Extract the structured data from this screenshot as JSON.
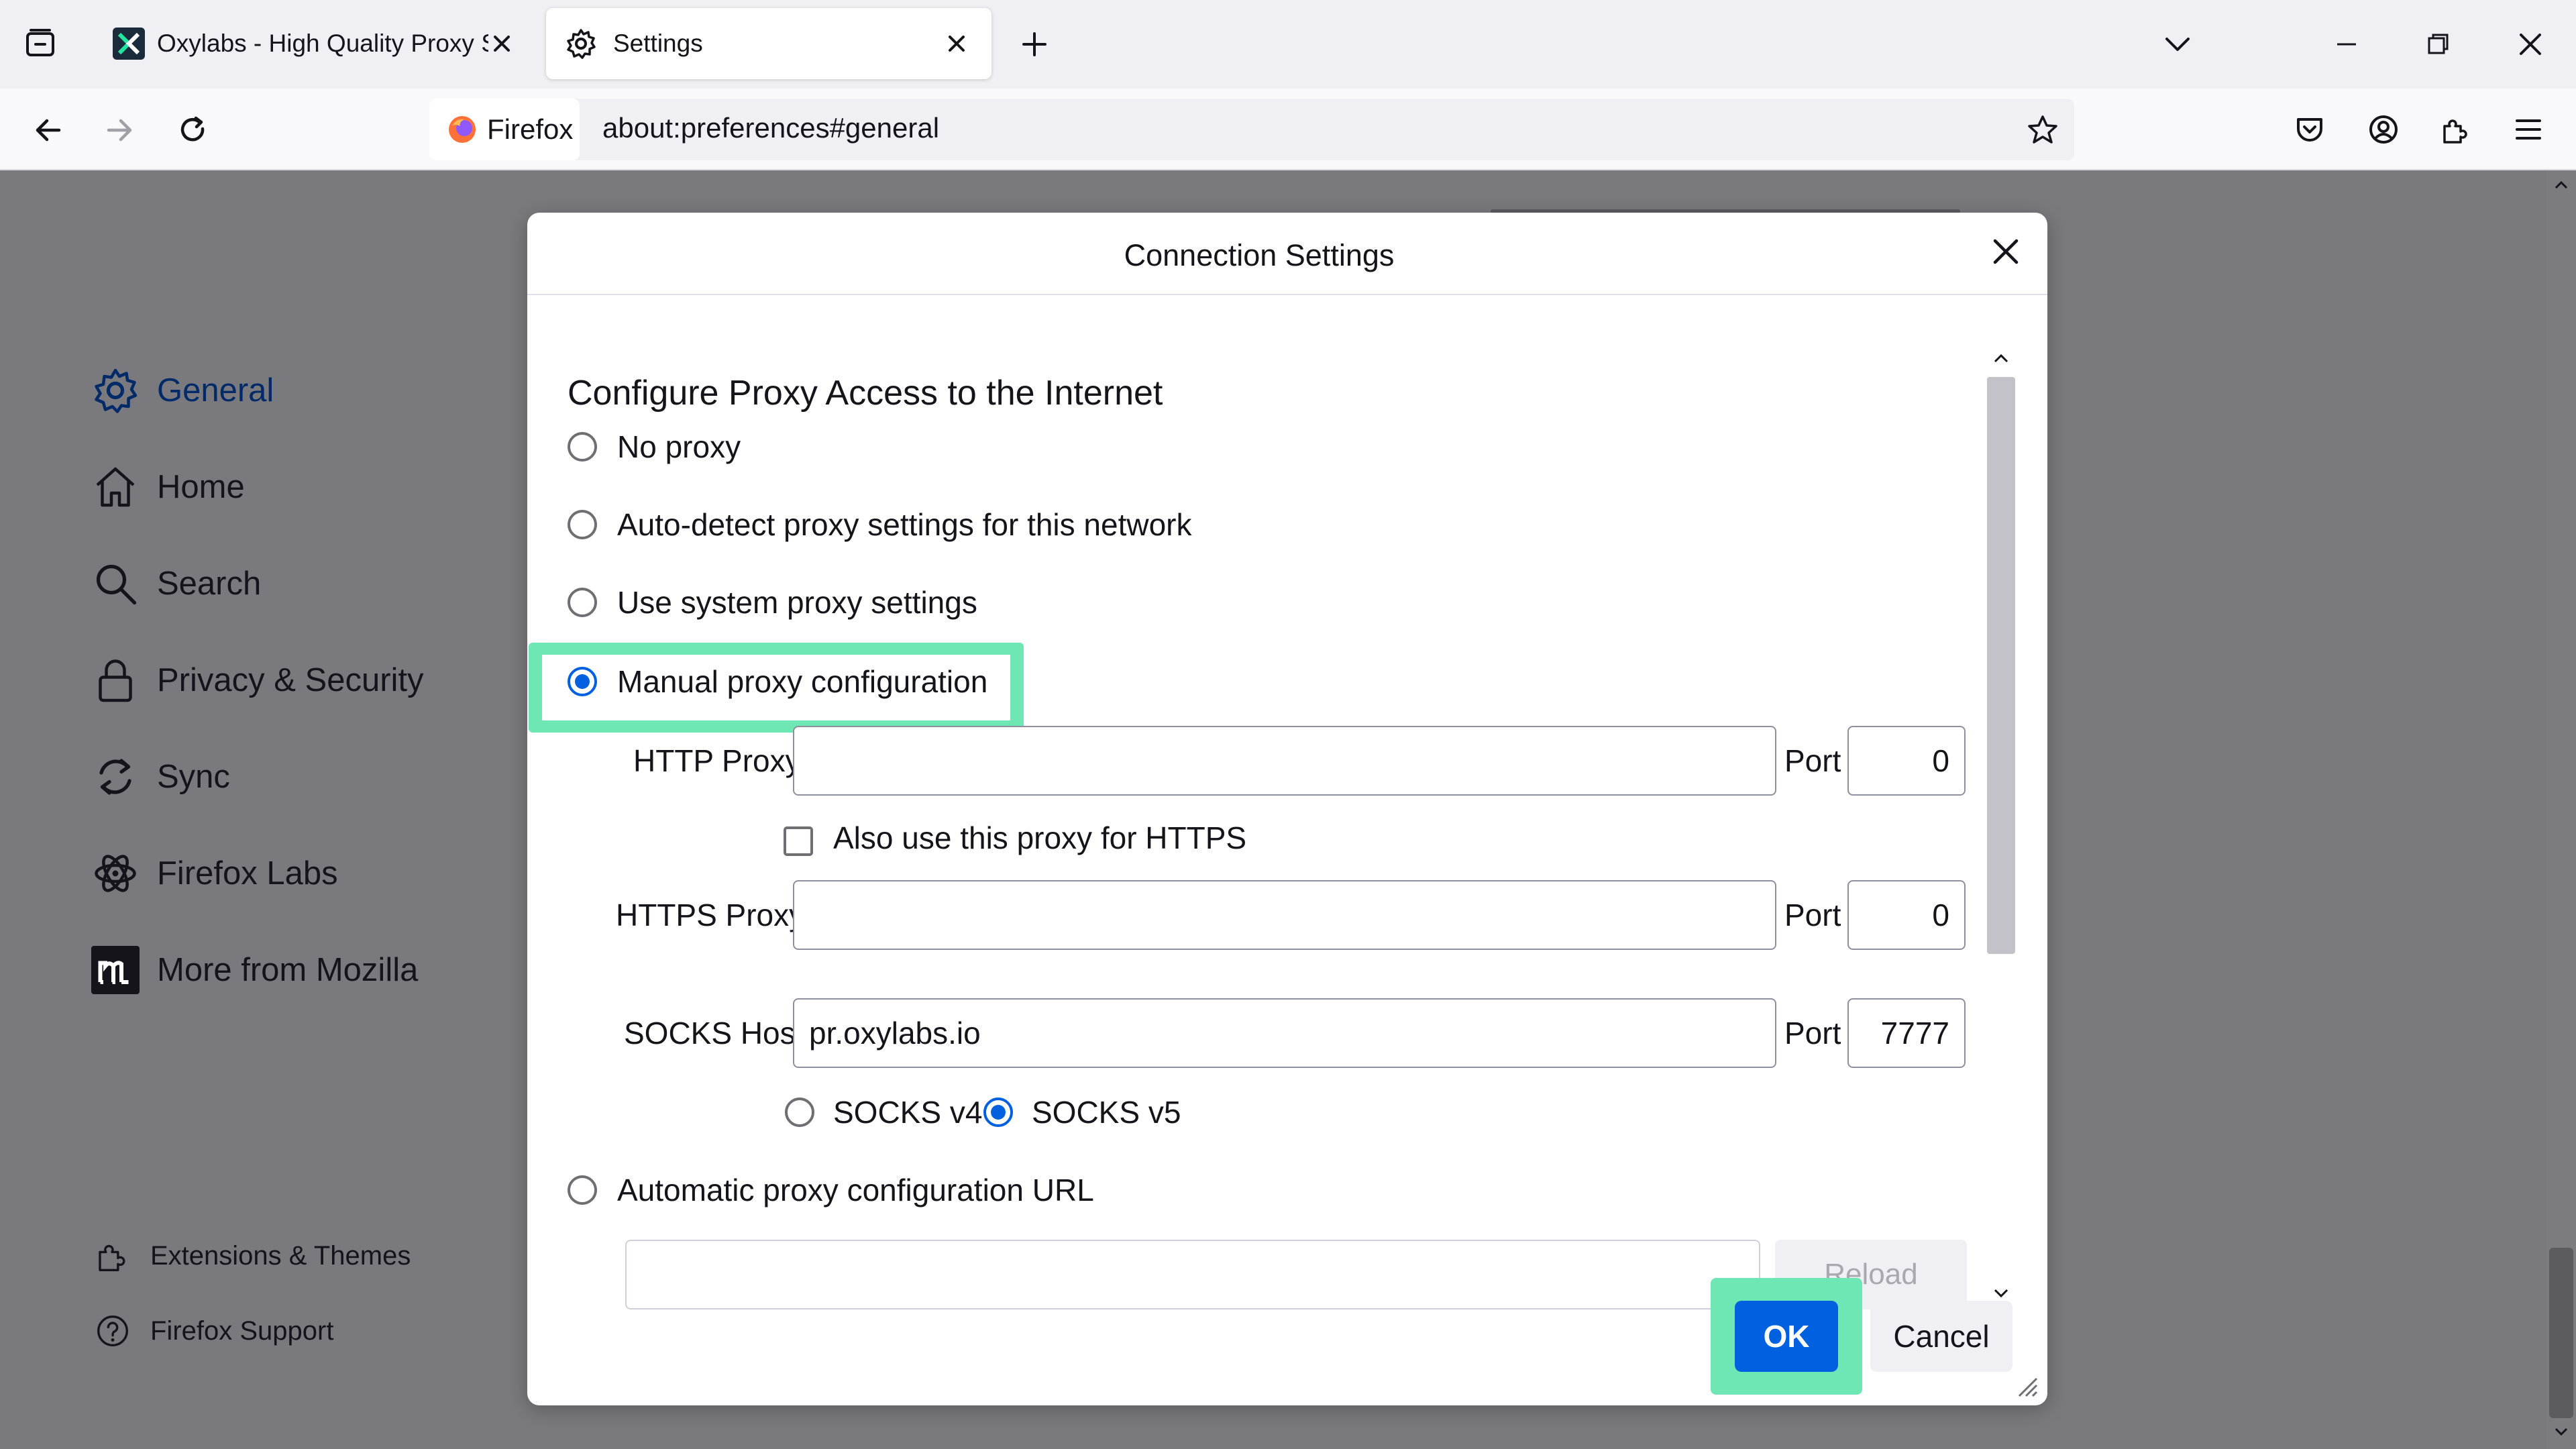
{
  "browser": {
    "tabs": [
      {
        "title": "Oxylabs - High Quality Proxy Se",
        "active": false
      },
      {
        "title": "Settings",
        "active": true
      }
    ],
    "url_identity": "Firefox",
    "url": "about:preferences#general"
  },
  "sidebar": {
    "items": [
      {
        "label": "General",
        "icon": "gear-icon",
        "selected": true
      },
      {
        "label": "Home",
        "icon": "home-icon"
      },
      {
        "label": "Search",
        "icon": "search-icon"
      },
      {
        "label": "Privacy & Security",
        "icon": "lock-icon"
      },
      {
        "label": "Sync",
        "icon": "sync-icon"
      },
      {
        "label": "Firefox Labs",
        "icon": "labs-icon"
      },
      {
        "label": "More from Mozilla",
        "icon": "mozilla-icon"
      }
    ],
    "footer": [
      {
        "label": "Extensions & Themes",
        "icon": "puzzle-icon"
      },
      {
        "label": "Firefox Support",
        "icon": "help-icon"
      }
    ]
  },
  "dialog": {
    "title": "Connection Settings",
    "section_title": "Configure Proxy Access to the Internet",
    "options": {
      "no_proxy": "No proxy",
      "auto_detect": "Auto-detect proxy settings for this network",
      "system": "Use system proxy settings",
      "manual": "Manual proxy configuration",
      "auto_url": "Automatic proxy configuration URL"
    },
    "selected_option": "manual",
    "http_proxy": {
      "label": "HTTP Proxy",
      "value": "",
      "port_label": "Port",
      "port": "0"
    },
    "also_https": {
      "label": "Also use this proxy for HTTPS",
      "checked": false
    },
    "https_proxy": {
      "label": "HTTPS Proxy",
      "value": "",
      "port_label": "Port",
      "port": "0"
    },
    "socks": {
      "label": "SOCKS Host",
      "value": "pr.oxylabs.io",
      "port_label": "Port",
      "port": "7777",
      "v4": "SOCKS v4",
      "v5": "SOCKS v5",
      "selected": "v5"
    },
    "auto_url_value": "",
    "reload_label": "Reload",
    "ok_label": "OK",
    "cancel_label": "Cancel"
  },
  "colors": {
    "accent": "#0060df",
    "highlight": "#6ee7b4",
    "overlay": "#7a7a7e"
  }
}
